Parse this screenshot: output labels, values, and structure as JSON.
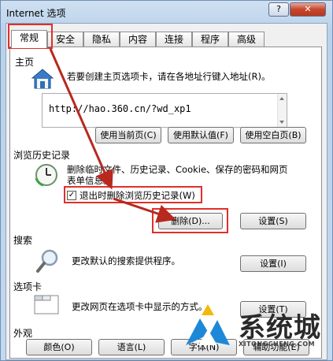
{
  "window": {
    "title": "Internet 选项",
    "help_label": "?",
    "close_label": "✕"
  },
  "tabs": [
    {
      "label": "常规"
    },
    {
      "label": "安全"
    },
    {
      "label": "隐私"
    },
    {
      "label": "内容"
    },
    {
      "label": "连接"
    },
    {
      "label": "程序"
    },
    {
      "label": "高级"
    }
  ],
  "home": {
    "section": "主页",
    "desc": "若要创建主页选项卡，请在各地址行键入地址(R)。",
    "url": "http://hao.360.cn/?wd_xp1",
    "buttons": [
      "使用当前页(C)",
      "使用默认值(F)",
      "使用空白页(B)"
    ]
  },
  "history": {
    "section": "浏览历史记录",
    "desc_line1": "删除临时文件、历史记录、Cookie、保存的密码和网页",
    "desc_line2": "表单信息。",
    "checkbox_label": "退出时删除浏览历史记录(W)",
    "checkbox_checked": true,
    "delete_label": "删除(D)...",
    "settings_label": "设置(S)"
  },
  "search": {
    "section": "搜索",
    "desc": "更改默认的搜索提供程序。",
    "settings_label": "设置(I)"
  },
  "tabs_section": {
    "section": "选项卡",
    "desc": "更改网页在选项卡中显示的方式。",
    "settings_label": "设置(T)"
  },
  "appearance": {
    "section": "外观",
    "buttons": [
      "颜色(O)",
      "语言(L)",
      "字体(N)",
      "辅助功能(E)"
    ]
  },
  "watermark": {
    "text": "系统城",
    "sub": "XITONGCHENG.COM"
  },
  "colors": {
    "highlight": "#e0302a",
    "accent": "#1e88d8"
  }
}
